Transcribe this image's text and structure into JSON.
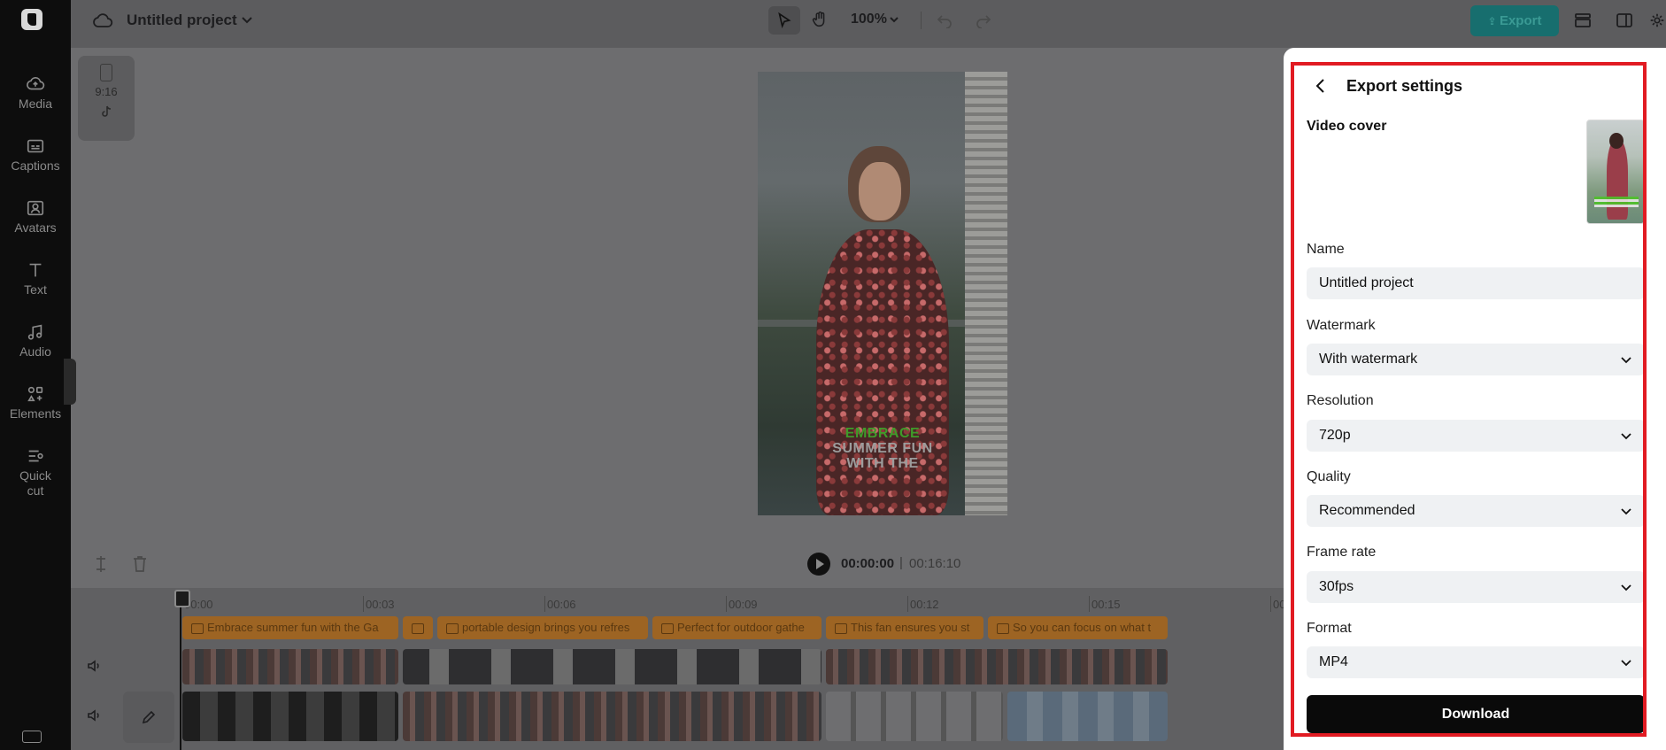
{
  "sidebar": {
    "items": [
      {
        "label": "Media",
        "icon": "cloud-upload-icon"
      },
      {
        "label": "Captions",
        "icon": "captions-icon"
      },
      {
        "label": "Avatars",
        "icon": "avatar-icon"
      },
      {
        "label": "Text",
        "icon": "text-icon"
      },
      {
        "label": "Audio",
        "icon": "music-note-icon"
      },
      {
        "label": "Elements",
        "icon": "elements-icon"
      },
      {
        "label": "Quick cut",
        "icon": "quick-cut-icon"
      }
    ]
  },
  "header": {
    "project_title": "Untitled project",
    "zoom": "100%",
    "export_label": "Export"
  },
  "format_chip": {
    "ratio": "9:16"
  },
  "preview": {
    "caption_line1": "EMBRACE",
    "caption_line2": "SUMMER FUN",
    "caption_line3": "WITH THE"
  },
  "player": {
    "current_time": "00:00:00",
    "separator": "|",
    "total_time": "00:16:10"
  },
  "timeline": {
    "ruler": [
      "00:00",
      "00:03",
      "00:06",
      "00:09",
      "00:12",
      "00:15",
      "00"
    ],
    "captions": [
      "Embrace summer fun with the Ga",
      "",
      "portable design brings you refres",
      "Perfect for outdoor gathe",
      "This fan ensures you st",
      "So you can focus on what t"
    ]
  },
  "export_panel": {
    "title": "Export settings",
    "video_cover_label": "Video cover",
    "name_label": "Name",
    "name_value": "Untitled project",
    "watermark_label": "Watermark",
    "watermark_value": "With watermark",
    "resolution_label": "Resolution",
    "resolution_value": "720p",
    "quality_label": "Quality",
    "quality_value": "Recommended",
    "frame_rate_label": "Frame rate",
    "frame_rate_value": "30fps",
    "format_label": "Format",
    "format_value": "MP4",
    "download_label": "Download"
  },
  "colors": {
    "accent": "#176e6e",
    "highlight": "#e11b22",
    "caption_clip": "#9d6423"
  }
}
